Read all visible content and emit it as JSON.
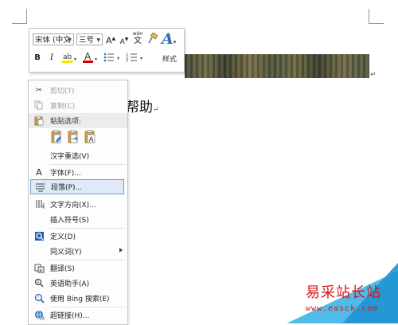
{
  "document": {
    "body_text": "帮助",
    "para_mark": "↵"
  },
  "mini_toolbar": {
    "font_name": "宋体 (中文",
    "font_size": "三号",
    "grow_font": "A",
    "shrink_font": "A",
    "phonetic": "wén",
    "bold": "B",
    "italic": "I",
    "styles_label": "样式",
    "colors": {
      "highlight": "#f5e600",
      "font_color": "#d40000",
      "accent": "#2e6db4"
    }
  },
  "context_menu": {
    "items": [
      {
        "label": "剪切(T)",
        "icon": "scissors-icon",
        "disabled": true
      },
      {
        "label": "复制(C)",
        "icon": "copy-icon",
        "disabled": true
      },
      {
        "label": "粘贴选项:",
        "icon": "clipboard-icon",
        "header": true
      },
      {
        "label": "汉字重选(V)"
      },
      {
        "label": "字体(F)...",
        "icon": "font-icon"
      },
      {
        "label": "段落(P)...",
        "icon": "paragraph-icon",
        "highlighted": true
      },
      {
        "label": "文字方向(X)...",
        "icon": "text-direction-icon"
      },
      {
        "label": "插入符号(S)"
      },
      {
        "label": "定义(D)",
        "icon": "define-icon"
      },
      {
        "label": "同义词(Y)",
        "submenu": true
      },
      {
        "label": "翻译(S)",
        "icon": "translate-icon"
      },
      {
        "label": "英语助手(A)",
        "icon": "english-assistant-icon"
      },
      {
        "label": "使用 Bing 搜索(E)",
        "icon": "search-icon"
      },
      {
        "label": "超链接(H)...",
        "icon": "hyperlink-icon"
      }
    ]
  },
  "watermark": {
    "site_name": "易采站长站",
    "url": "www.easck.com"
  }
}
